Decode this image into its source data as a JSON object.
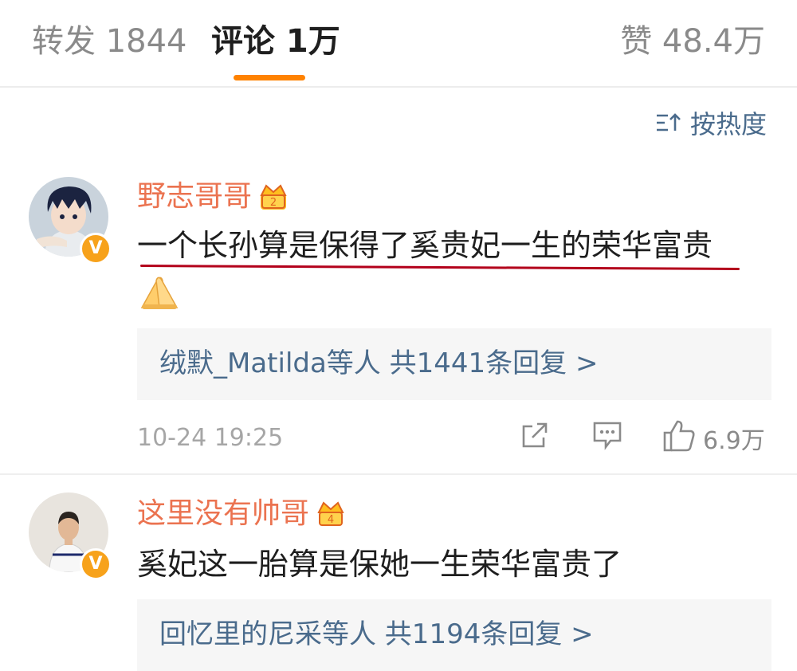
{
  "tabs": {
    "repost": "转发 1844",
    "comments": "评论 1万",
    "likes": "赞 48.4万"
  },
  "sort": {
    "label": "按热度"
  },
  "comments": [
    {
      "username": "野志哥哥",
      "text": "一个长孙算是保得了奚贵妃一生的荣华富贵",
      "emoji": "folded-hands-emoji",
      "verified_badge": "V",
      "replies_text": "绒默_Matilda等人  共1441条回复 >",
      "timestamp": "10-24 19:25",
      "like_count": "6.9万"
    },
    {
      "username": "这里没有帅哥",
      "text": "奚妃这一胎算是保她一生荣华富贵了",
      "verified_badge": "V",
      "replies_text": "回忆里的尼采等人  共1194条回复 >"
    }
  ],
  "colors": {
    "accent": "#ff8200",
    "username": "#eb7350",
    "link": "#4a6b8c",
    "muted": "#a6a6a6",
    "annotation_underline": "#b3001b"
  }
}
